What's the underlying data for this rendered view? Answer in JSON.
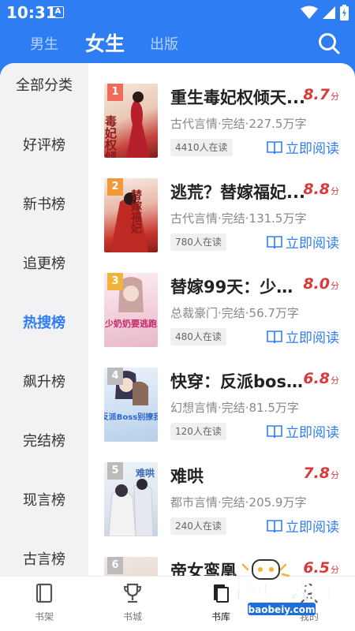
{
  "status_bar": {
    "time": "10:31",
    "notif_letter": "A"
  },
  "top_nav": {
    "tabs": [
      "男生",
      "女生",
      "出版"
    ],
    "active_tab": "女生"
  },
  "sidebar": {
    "items": [
      "全部分类",
      "好评榜",
      "新书榜",
      "追更榜",
      "热搜榜",
      "飙升榜",
      "完结榜",
      "现言榜",
      "古言榜"
    ],
    "active": "热搜榜"
  },
  "books": [
    {
      "rank": "1",
      "title": "重生毒妃权倾天...",
      "score": "8.7",
      "score_unit": "分",
      "meta": "古代言情·完结·227.5万字",
      "readers": "4410人在读",
      "action": "立即阅读",
      "cover_text": "毒妃权倾天下"
    },
    {
      "rank": "2",
      "title": "逃荒？替嫁福妃...",
      "score": "8.8",
      "score_unit": "分",
      "meta": "古代言情·完结·131.5万字",
      "readers": "780人在读",
      "action": "立即阅读",
      "cover_text": "替嫁福妃"
    },
    {
      "rank": "3",
      "title": "替嫁99天：少奶...",
      "score": "8.0",
      "score_unit": "分",
      "meta": "总裁豪门·完结·56.7万字",
      "readers": "480人在读",
      "action": "立即阅读",
      "cover_text": "少奶奶要逃跑"
    },
    {
      "rank": "4",
      "title": "快穿：反派boss...",
      "score": "6.8",
      "score_unit": "分",
      "meta": "幻想言情·完结·81.5万字",
      "readers": "120人在读",
      "action": "立即阅读",
      "cover_text": "反派Boss别撩我"
    },
    {
      "rank": "5",
      "title": "难哄",
      "score": "7.8",
      "score_unit": "分",
      "meta": "都市言情·完结·205.9万字",
      "readers": "240人在读",
      "action": "立即阅读",
      "cover_text": "难哄"
    },
    {
      "rank": "6",
      "title": "帝女鸾凰",
      "score": "6.5",
      "score_unit": "分",
      "meta": "",
      "readers": "",
      "action": "",
      "cover_text": ""
    }
  ],
  "bottom_nav": {
    "items": [
      "书架",
      "书城",
      "书库",
      "我的"
    ],
    "active": "书库"
  },
  "watermark": {
    "title": "宝贝游戏网",
    "url": "baobeiy.com"
  },
  "colors": {
    "primary": "#2f7df3",
    "score": "#d93a3a",
    "rank_1": "#f26b5a",
    "rank_2": "#f29a3a",
    "rank_3": "#f2b33a",
    "rank_other": "#bbbbbb"
  }
}
